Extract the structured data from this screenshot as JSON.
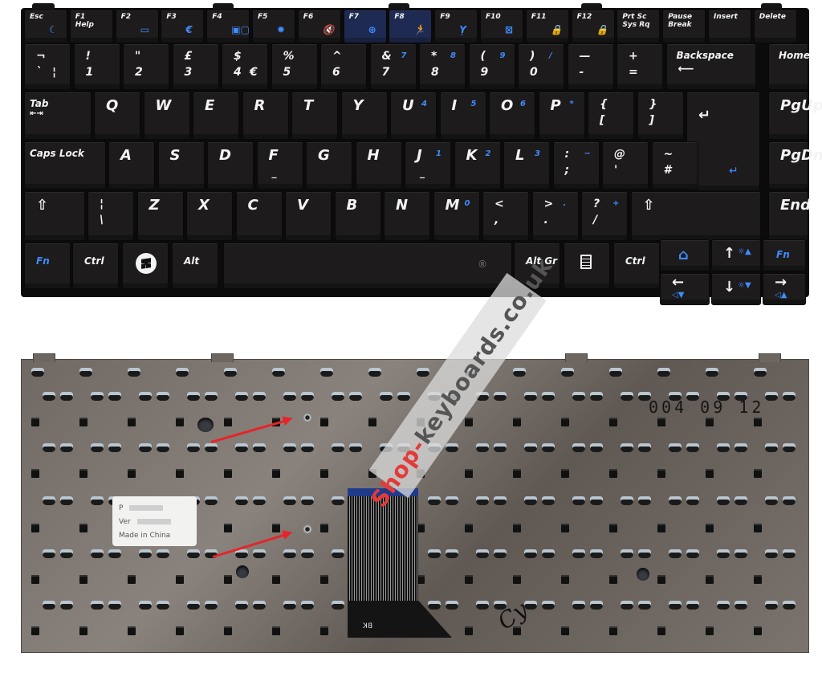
{
  "front": {
    "function_row": [
      {
        "label": "Esc",
        "fn_icon": "moon-sleep-icon",
        "fn_glyph": "☾"
      },
      {
        "label": "F1",
        "sub": "Help"
      },
      {
        "label": "F2",
        "fn_icon": "battery-icon",
        "fn_glyph": "▭"
      },
      {
        "label": "F3",
        "fn_icon": "euro-icon",
        "fn_glyph": "€"
      },
      {
        "label": "F4",
        "fn_icon": "display-switch-icon",
        "fn_glyph": "▣▢"
      },
      {
        "label": "F5",
        "fn_icon": "brightness-icon",
        "fn_glyph": "✹"
      },
      {
        "label": "F6",
        "fn_icon": "mute-icon",
        "fn_glyph": "🔇"
      },
      {
        "label": "F7",
        "fn_icon": "plugin-icon",
        "fn_glyph": "⊕"
      },
      {
        "label": "F8",
        "fn_icon": "running-man-icon",
        "fn_glyph": "🏃"
      },
      {
        "label": "F9",
        "fn_icon": "wireless-antenna-icon",
        "fn_glyph": "Ỵ"
      },
      {
        "label": "F10",
        "fn_icon": "touchpad-icon",
        "fn_glyph": "⊠"
      },
      {
        "label": "F11",
        "fn_icon": "num-lock-icon",
        "fn_glyph": "🔒"
      },
      {
        "label": "F12",
        "fn_icon": "scroll-lock-icon",
        "fn_glyph": "🔒"
      },
      {
        "label": "Prt Sc",
        "sub": "Sys Rq"
      },
      {
        "label": "Pause",
        "sub": "Break"
      },
      {
        "label": "Insert"
      },
      {
        "label": "Delete"
      }
    ],
    "number_row": [
      {
        "top": "¬",
        "bottom": "`",
        "alt": "¦"
      },
      {
        "top": "!",
        "bottom": "1"
      },
      {
        "top": "\"",
        "bottom": "2"
      },
      {
        "top": "£",
        "bottom": "3"
      },
      {
        "top": "$",
        "bottom": "4",
        "alt": "€"
      },
      {
        "top": "%",
        "bottom": "5"
      },
      {
        "top": "^",
        "bottom": "6"
      },
      {
        "top": "&",
        "bottom": "7",
        "num": "7"
      },
      {
        "top": "*",
        "bottom": "8",
        "num": "8"
      },
      {
        "top": "(",
        "bottom": "9",
        "num": "9"
      },
      {
        "top": ")",
        "bottom": "0",
        "num": "/"
      },
      {
        "top": "—",
        "bottom": "-"
      },
      {
        "top": "+",
        "bottom": "="
      },
      {
        "label": "Backspace",
        "arrow": "⟵"
      },
      {
        "label": "Home"
      }
    ],
    "qwerty_row": [
      {
        "label": "Tab",
        "sub": "⇤⇥"
      },
      {
        "label": "Q"
      },
      {
        "label": "W"
      },
      {
        "label": "E"
      },
      {
        "label": "R"
      },
      {
        "label": "T"
      },
      {
        "label": "Y"
      },
      {
        "label": "U",
        "num": "4"
      },
      {
        "label": "I",
        "num": "5"
      },
      {
        "label": "O",
        "num": "6"
      },
      {
        "label": "P",
        "num": "*"
      },
      {
        "top": "{",
        "bottom": "["
      },
      {
        "top": "}",
        "bottom": "]"
      },
      {
        "label": "↵"
      },
      {
        "label": "PgUp"
      }
    ],
    "home_row": [
      {
        "label": "Caps Lock"
      },
      {
        "label": "A"
      },
      {
        "label": "S"
      },
      {
        "label": "D"
      },
      {
        "label": "F",
        "bump": "_"
      },
      {
        "label": "G"
      },
      {
        "label": "H"
      },
      {
        "label": "J",
        "num": "1",
        "bump": "_"
      },
      {
        "label": "K",
        "num": "2"
      },
      {
        "label": "L",
        "num": "3"
      },
      {
        "top": ":",
        "bottom": ";",
        "num": "−"
      },
      {
        "top": "@",
        "bottom": "'"
      },
      {
        "top": "~",
        "bottom": "#"
      },
      {
        "label": "↵",
        "blue_enter": "↵"
      },
      {
        "label": "PgDn"
      }
    ],
    "shift_row": [
      {
        "label": "⇧"
      },
      {
        "top": "¦",
        "bottom": "\\"
      },
      {
        "label": "Z"
      },
      {
        "label": "X"
      },
      {
        "label": "C"
      },
      {
        "label": "V"
      },
      {
        "label": "B"
      },
      {
        "label": "N"
      },
      {
        "label": "M",
        "num": "0"
      },
      {
        "top": "<",
        "bottom": ","
      },
      {
        "top": ">",
        "bottom": ".",
        "num": "."
      },
      {
        "top": "?",
        "bottom": "/",
        "num": "+"
      },
      {
        "label": "⇧"
      },
      {
        "label": "End"
      }
    ],
    "bottom_row": [
      {
        "label": "Fn"
      },
      {
        "label": "Ctrl"
      },
      {
        "label": "windows-logo"
      },
      {
        "label": "Alt"
      },
      {
        "label": ""
      },
      {
        "label": "Alt Gr"
      },
      {
        "label": "menu"
      },
      {
        "label": "Ctrl"
      }
    ],
    "arrow_cluster": {
      "home_icon": "⌂",
      "up": "↑",
      "up_fn": "☼▲",
      "fn": "Fn",
      "left": "←",
      "left_fn": "◁▼",
      "down": "↓",
      "down_fn": "☼▼",
      "right": "→",
      "right_fn": "◁▲"
    }
  },
  "back": {
    "sticker": {
      "line1": "P",
      "line2": "Ver",
      "line3": "Made in China"
    },
    "date_stamp": "004 09 12",
    "cable_code": "BK",
    "handwriting": "Cy"
  },
  "watermark": {
    "brand": "Shop-",
    "rest": "keyboards.co.uk",
    "registered": "®"
  },
  "colors": {
    "key_legend_fn": "#3f8cff",
    "key_face": "#1d1b1b",
    "accent_arrow": "#e5252a",
    "plate": "#7a736d"
  }
}
